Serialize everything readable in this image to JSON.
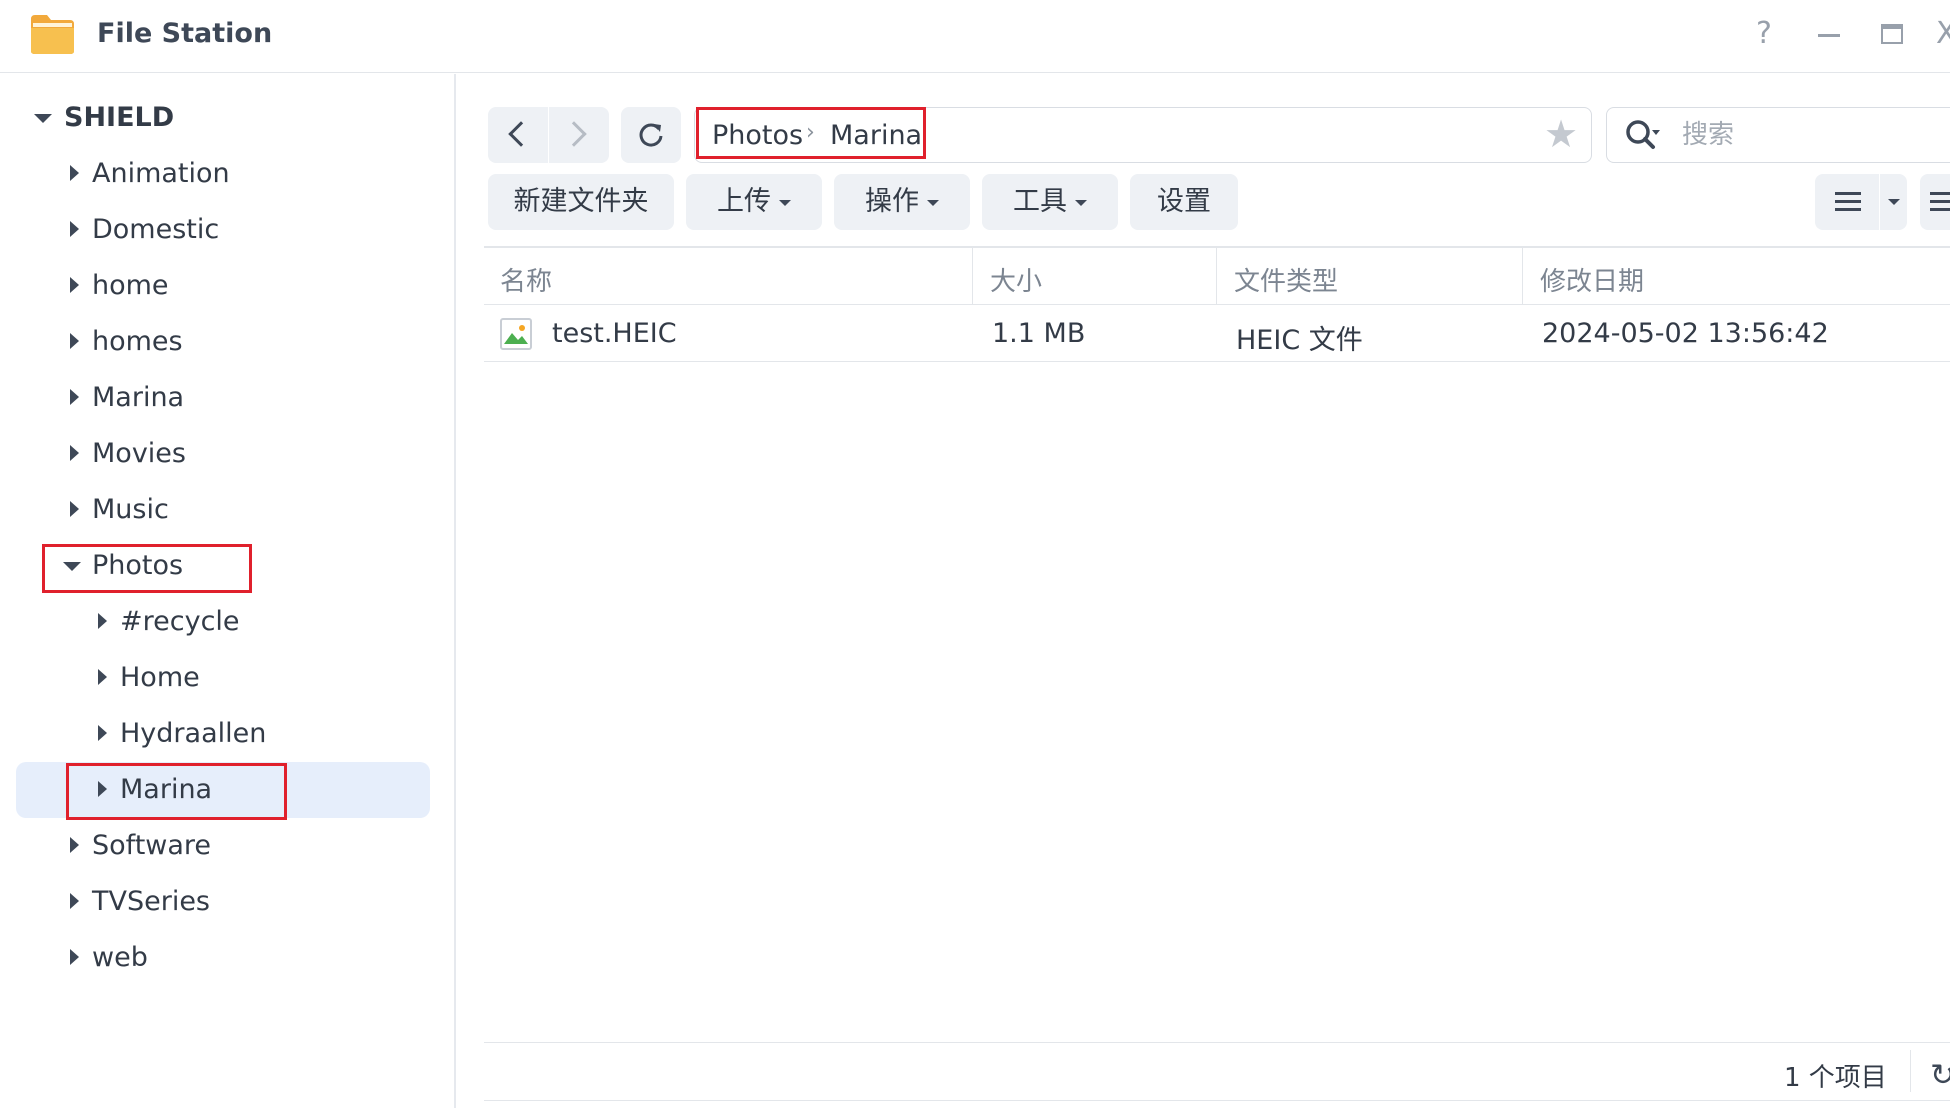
{
  "window": {
    "title": "File Station",
    "help": "?",
    "minimize": "—",
    "maximize": "□",
    "close": "X"
  },
  "sidebar": {
    "root": "SHIELD",
    "items": [
      {
        "label": "Animation"
      },
      {
        "label": "Domestic"
      },
      {
        "label": "home"
      },
      {
        "label": "homes"
      },
      {
        "label": "Marina"
      },
      {
        "label": "Movies"
      },
      {
        "label": "Music"
      },
      {
        "label": "Photos",
        "expanded": true,
        "children": [
          {
            "label": "#recycle"
          },
          {
            "label": "Home"
          },
          {
            "label": "Hydraallen"
          },
          {
            "label": "Marina",
            "selected": true
          }
        ]
      },
      {
        "label": "Software"
      },
      {
        "label": "TVSeries"
      },
      {
        "label": "web"
      }
    ]
  },
  "path": {
    "crumbs": [
      "Photos",
      "Marina"
    ],
    "separator": "›"
  },
  "search": {
    "placeholder": "搜索"
  },
  "toolbar": {
    "new_folder": "新建文件夹",
    "upload": "上传",
    "action": "操作",
    "tools": "工具",
    "settings": "设置"
  },
  "table": {
    "columns": [
      "名称",
      "大小",
      "文件类型",
      "修改日期"
    ],
    "rows": [
      {
        "name": "test.HEIC",
        "size": "1.1 MB",
        "type": "HEIC 文件",
        "modified": "2024-05-02 13:56:42"
      }
    ]
  },
  "status": {
    "count": "1 个项目"
  },
  "colors": {
    "accent_selection": "#e6eefb",
    "highlight_box": "#e0202c",
    "button_bg": "#eef1f5",
    "text": "#333b47"
  }
}
